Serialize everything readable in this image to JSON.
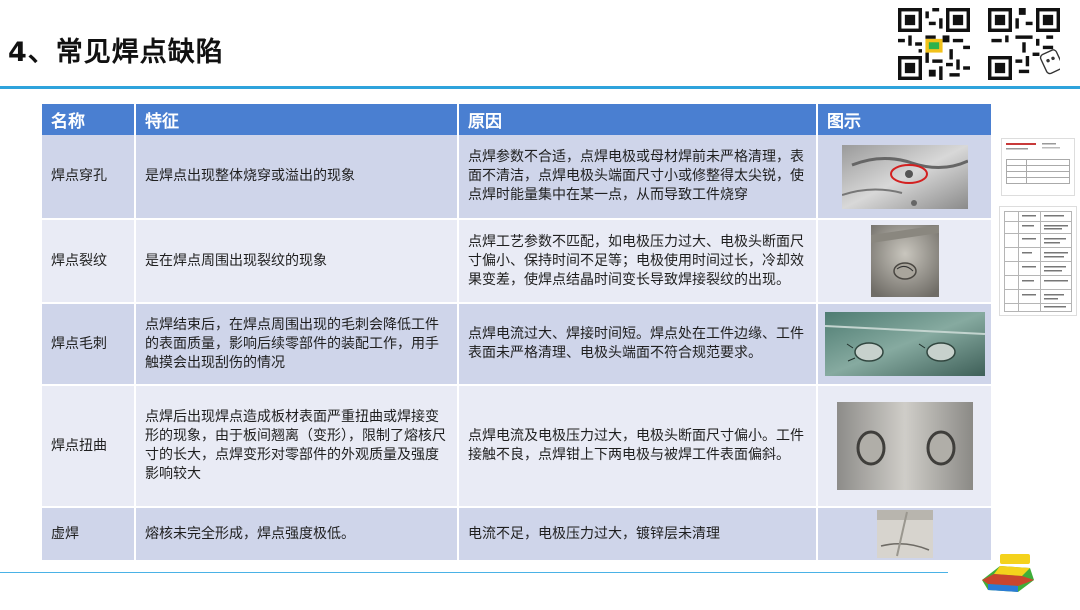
{
  "slide": {
    "title": "4、常见焊点缺陷"
  },
  "table": {
    "headers": [
      "名称",
      "特征",
      "原因",
      "图示"
    ],
    "rows": [
      {
        "name": "焊点穿孔",
        "feature": "是焊点出现整体烧穿或溢出的现象",
        "cause": "点焊参数不合适，点焊电极或母材焊前未严格清理，表面不清洁，点焊电极头端面尺寸小或修整得太尖锐，使点焊时能量集中在某一点，从而导致工件烧穿"
      },
      {
        "name": "焊点裂纹",
        "feature": "是在焊点周围出现裂纹的现象",
        "cause": "点焊工艺参数不匹配，如电极压力过大、电极头断面尺寸偏小、保持时间不足等；电极使用时间过长，冷却效果变差，使焊点结晶时间变长导致焊接裂纹的出现。"
      },
      {
        "name": "焊点毛刺",
        "feature": "点焊结束后，在焊点周围出现的毛刺会降低工件的表面质量，影响后续零部件的装配工作，用手触摸会出现刮伤的情况",
        "cause": "点焊电流过大、焊接时间短。焊点处在工件边缘、工件表面未严格清理、电极头端面不符合规范要求。"
      },
      {
        "name": "焊点扭曲",
        "feature": "点焊后出现焊点造成板材表面严重扭曲或焊接变形的现象，由于板间翘离（变形），限制了熔核尺寸的长大，点焊变形对零部件的外观质量及强度影响较大",
        "cause": "点焊电流及电极压力过大，电极头断面尺寸偏小。工件接触不良，点焊钳上下两电极与被焊工件表面偏斜。"
      },
      {
        "name": "虚焊",
        "feature": "熔核未完全形成，焊点强度极低。",
        "cause": "电流不足，电极压力过大，镀锌层未清理"
      }
    ]
  },
  "colors": {
    "accent": "#2ea3dc",
    "header_bg": "#4a7fd1",
    "row_odd": "#cfd5ea",
    "row_even": "#e9ebf5"
  },
  "icons": [
    "qr-code-icon",
    "qr-code-icon",
    "cae-logo-icon"
  ]
}
